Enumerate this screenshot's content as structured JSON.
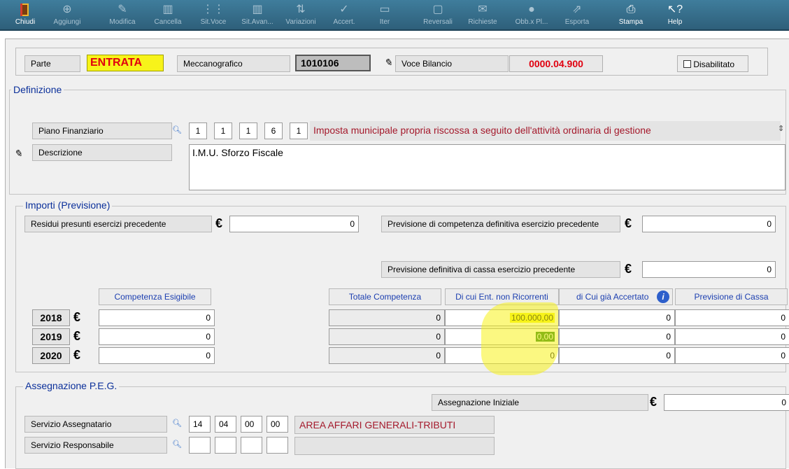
{
  "toolbar": {
    "buttons": [
      {
        "label": "Chiudi",
        "icon": "exit-door-icon",
        "enabled": true
      },
      {
        "label": "Aggiungi",
        "icon": "plus-icon",
        "enabled": false
      },
      {
        "label": "Modifica",
        "icon": "pencil-icon",
        "enabled": false
      },
      {
        "label": "Cancella",
        "icon": "trash-icon",
        "enabled": false
      },
      {
        "label": "Sit.Voce",
        "icon": "tree-icon",
        "enabled": false
      },
      {
        "label": "Sit.Avan...",
        "icon": "chart-icon",
        "enabled": false
      },
      {
        "label": "Variazioni",
        "icon": "variations-icon",
        "enabled": false
      },
      {
        "label": "Accert.",
        "icon": "check-icon",
        "enabled": false
      },
      {
        "label": "Iter",
        "icon": "workflow-icon",
        "enabled": false
      },
      {
        "label": "Reversali",
        "icon": "receipt-icon",
        "enabled": false
      },
      {
        "label": "Richieste",
        "icon": "request-icon",
        "enabled": false
      },
      {
        "label": "Obb.x Pl...",
        "icon": "circle-icon",
        "enabled": false
      },
      {
        "label": "Esporta",
        "icon": "export-icon",
        "enabled": false
      },
      {
        "label": "Stampa",
        "icon": "printer-icon",
        "enabled": true
      },
      {
        "label": "Help",
        "icon": "help-icon",
        "enabled": true
      }
    ]
  },
  "header": {
    "parte_label": "Parte",
    "parte_value": "ENTRATA",
    "meccanografico_label": "Meccanografico",
    "meccanografico_value": "1010106",
    "voce_bilancio_label": "Voce Bilancio",
    "voce_bilancio_value": "0000.04.900",
    "disabilitato_label": "Disabilitato",
    "disabilitato_checked": false
  },
  "definizione": {
    "legend": "Definizione",
    "piano_label": "Piano Finanziario",
    "piano_codes": [
      "1",
      "1",
      "1",
      "6",
      "1"
    ],
    "piano_desc": "Imposta municipale propria riscossa a seguito dell'attività ordinaria di gestione",
    "descrizione_label": "Descrizione",
    "descrizione_value": "I.M.U. Sforzo Fiscale"
  },
  "importi": {
    "legend": "Importi (Previsione)",
    "residui_label": "Residui presunti esercizi precedente",
    "residui_value": "0",
    "prev_comp_label": "Previsione di competenza definitiva esercizio precedente",
    "prev_comp_value": "0",
    "prev_cassa_label": "Previsione definitiva di cassa esercizio precedente",
    "prev_cassa_value": "0",
    "euro_symbol": "€",
    "columns": {
      "competenza": "Competenza Esigibile",
      "totale": "Totale Competenza",
      "non_ricorrenti": "Di cui Ent. non Ricorrenti",
      "accertato": "di Cui già Accertato",
      "cassa": "Previsione di Cassa"
    },
    "rows": [
      {
        "year": "2018",
        "competenza": "0",
        "totale": "0",
        "non_ricorrenti": "100.000,00",
        "accertato": "0",
        "cassa": "0"
      },
      {
        "year": "2019",
        "competenza": "0",
        "totale": "0",
        "non_ricorrenti": "0,00",
        "accertato": "0",
        "cassa": "0"
      },
      {
        "year": "2020",
        "competenza": "0",
        "totale": "0",
        "non_ricorrenti": "0",
        "accertato": "0",
        "cassa": "0"
      }
    ]
  },
  "peg": {
    "legend": "Assegnazione P.E.G.",
    "assegnazione_label": "Assegnazione Iniziale",
    "assegnazione_value": "0",
    "serv_assegnatario_label": "Servizio Assegnatario",
    "serv_assegnatario_codes": [
      "14",
      "04",
      "00",
      "00"
    ],
    "serv_assegnatario_desc": "AREA AFFARI GENERALI-TRIBUTI",
    "serv_responsabile_label": "Servizio Responsabile",
    "serv_responsabile_codes": [
      "",
      "",
      "",
      ""
    ],
    "serv_responsabile_desc": ""
  },
  "colors": {
    "toolbar": "#2e5f7a",
    "highlight": "#f7f31a",
    "accent_red": "#e0000f",
    "legend_blue": "#0a2f9a"
  }
}
